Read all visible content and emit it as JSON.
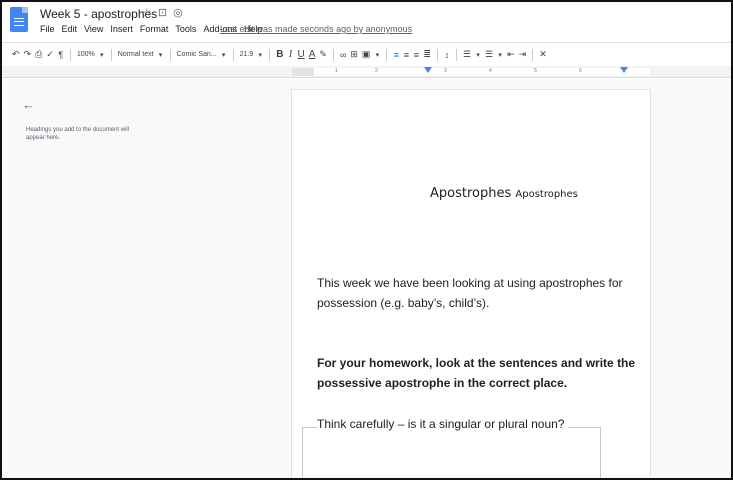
{
  "window": {
    "title": "Week 5 - apostrophes",
    "last_edit": "Last edit was made seconds ago by anonymous"
  },
  "title_icons": [
    "star-icon",
    "move-to-folder-icon",
    "cloud-status-icon"
  ],
  "menu": [
    "File",
    "Edit",
    "View",
    "Insert",
    "Format",
    "Tools",
    "Add-ons",
    "Help"
  ],
  "toolbar": {
    "zoom": "100%",
    "style": "Normal text",
    "font": "Comic San...",
    "font_size": "21.9",
    "bold": "B",
    "italic": "I",
    "underline": "U",
    "text_color": "A"
  },
  "ruler": {
    "numbers": [
      "1",
      "2",
      "3",
      "4",
      "5",
      "6"
    ]
  },
  "outline": {
    "back": "←",
    "hint": "Headings you add to the document will appear here."
  },
  "document": {
    "heading_main": "Apostrophes",
    "heading_sub": "Apostrophes",
    "para1": "This week we have been looking at using apostrophes for possession (e.g. baby’s, child’s).",
    "para2": "For your homework, look at the sentences and write the possessive apostrophe in the correct place.",
    "para3": "Think carefully – is it a singular or plural noun?"
  },
  "colors": {
    "docs_blue": "#4285f4",
    "accent": "#1a73e8"
  }
}
